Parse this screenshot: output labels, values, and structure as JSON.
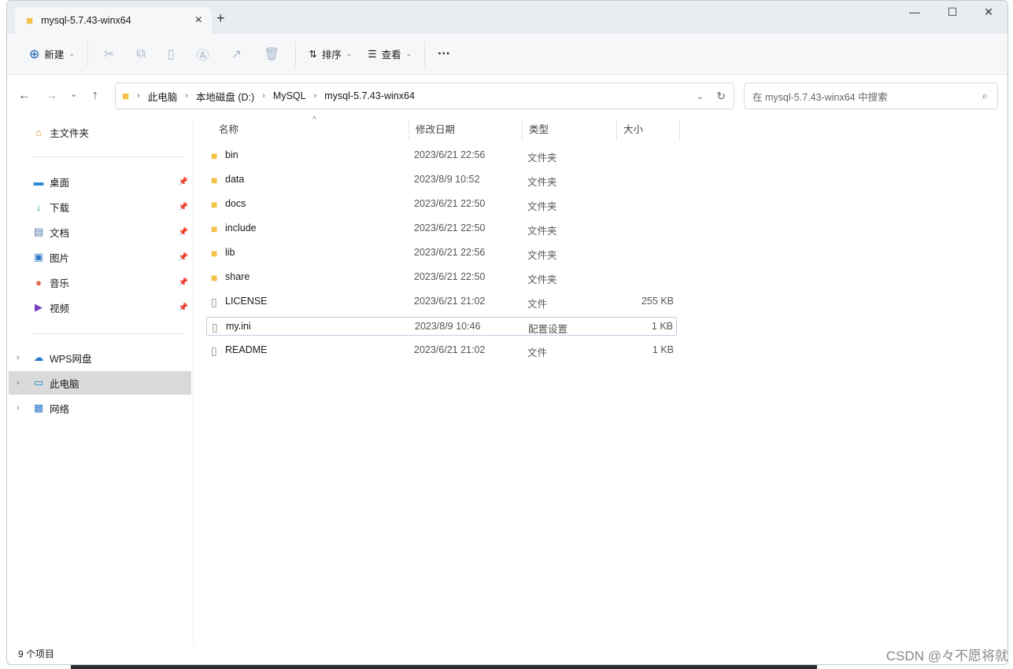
{
  "window": {
    "tab_title": "mysql-5.7.43-winx64",
    "new_tab": "+",
    "minimize": "—",
    "maximize": "☐",
    "close": "✕"
  },
  "toolbar": {
    "new_label": "新建",
    "sort_label": "排序",
    "view_label": "查看",
    "more": "···"
  },
  "address": {
    "crumbs": [
      "此电脑",
      "本地磁盘 (D:)",
      "MySQL",
      "mysql-5.7.43-winx64"
    ],
    "search_placeholder": "在 mysql-5.7.43-winx64 中搜索"
  },
  "sidebar": {
    "home": "主文件夹",
    "quick": [
      {
        "label": "桌面",
        "icon": "desktop-icon"
      },
      {
        "label": "下载",
        "icon": "download-icon"
      },
      {
        "label": "文档",
        "icon": "document-icon"
      },
      {
        "label": "图片",
        "icon": "pictures-icon"
      },
      {
        "label": "音乐",
        "icon": "music-icon"
      },
      {
        "label": "视频",
        "icon": "video-icon"
      }
    ],
    "tree": [
      {
        "label": "WPS网盘"
      },
      {
        "label": "此电脑"
      },
      {
        "label": "网络"
      }
    ]
  },
  "columns": {
    "name": "名称",
    "date": "修改日期",
    "type": "类型",
    "size": "大小"
  },
  "files": [
    {
      "name": "bin",
      "date": "2023/6/21 22:56",
      "type": "文件夹",
      "size": "",
      "icon": "folder-icon"
    },
    {
      "name": "data",
      "date": "2023/8/9 10:52",
      "type": "文件夹",
      "size": "",
      "icon": "folder-icon"
    },
    {
      "name": "docs",
      "date": "2023/6/21 22:50",
      "type": "文件夹",
      "size": "",
      "icon": "folder-icon"
    },
    {
      "name": "include",
      "date": "2023/6/21 22:50",
      "type": "文件夹",
      "size": "",
      "icon": "folder-icon"
    },
    {
      "name": "lib",
      "date": "2023/6/21 22:56",
      "type": "文件夹",
      "size": "",
      "icon": "folder-icon"
    },
    {
      "name": "share",
      "date": "2023/6/21 22:50",
      "type": "文件夹",
      "size": "",
      "icon": "folder-icon"
    },
    {
      "name": "LICENSE",
      "date": "2023/6/21 21:02",
      "type": "文件",
      "size": "255 KB",
      "icon": "file-icon"
    },
    {
      "name": "my.ini",
      "date": "2023/8/9 10:46",
      "type": "配置设置",
      "size": "1 KB",
      "icon": "settings-file-icon"
    },
    {
      "name": "README",
      "date": "2023/6/21 21:02",
      "type": "文件",
      "size": "1 KB",
      "icon": "file-icon"
    }
  ],
  "status": {
    "count": "9 个项目"
  },
  "watermark": "CSDN @々不愿将就"
}
